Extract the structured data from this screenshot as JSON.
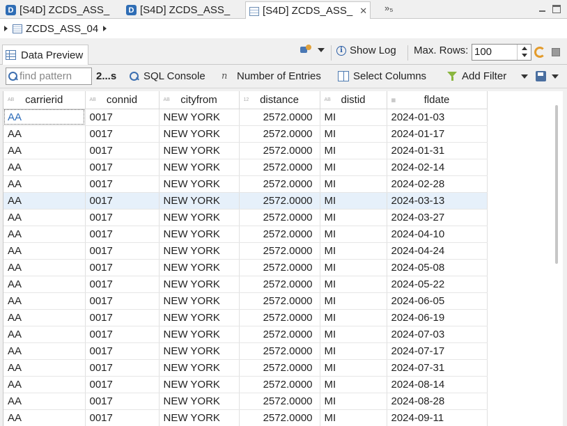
{
  "editor_tabs": [
    {
      "label": "[S4D] ZCDS_ASS_",
      "icon": "ddic-d-icon"
    },
    {
      "label": "[S4D] ZCDS_ASS_",
      "icon": "ddic-d-icon"
    },
    {
      "label": "[S4D] ZCDS_ASS_",
      "icon": "data-preview-icon",
      "active": true
    }
  ],
  "tab_overflow": "»₅",
  "breadcrumb": {
    "entity": "ZCDS_ASS_04"
  },
  "view": {
    "tab_label": "Data Preview"
  },
  "header": {
    "show_log": "Show Log",
    "max_rows_label": "Max. Rows:",
    "max_rows_value": "100"
  },
  "toolbar": {
    "find_placeholder": "find pattern",
    "count": "2...s",
    "sql_console": "SQL Console",
    "number_of_entries": "Number of Entries",
    "select_columns": "Select Columns",
    "add_filter": "Add Filter"
  },
  "table": {
    "columns": [
      {
        "label": "carrierid",
        "type": "AB"
      },
      {
        "label": "connid",
        "type": "AB"
      },
      {
        "label": "cityfrom",
        "type": "AB"
      },
      {
        "label": "distance",
        "type": "12"
      },
      {
        "label": "distid",
        "type": "AB"
      },
      {
        "label": "fldate",
        "type": "date"
      }
    ],
    "rows": [
      [
        "AA",
        "0017",
        "NEW YORK",
        "2572.0000",
        "MI",
        "2024-01-03"
      ],
      [
        "AA",
        "0017",
        "NEW YORK",
        "2572.0000",
        "MI",
        "2024-01-17"
      ],
      [
        "AA",
        "0017",
        "NEW YORK",
        "2572.0000",
        "MI",
        "2024-01-31"
      ],
      [
        "AA",
        "0017",
        "NEW YORK",
        "2572.0000",
        "MI",
        "2024-02-14"
      ],
      [
        "AA",
        "0017",
        "NEW YORK",
        "2572.0000",
        "MI",
        "2024-02-28"
      ],
      [
        "AA",
        "0017",
        "NEW YORK",
        "2572.0000",
        "MI",
        "2024-03-13"
      ],
      [
        "AA",
        "0017",
        "NEW YORK",
        "2572.0000",
        "MI",
        "2024-03-27"
      ],
      [
        "AA",
        "0017",
        "NEW YORK",
        "2572.0000",
        "MI",
        "2024-04-10"
      ],
      [
        "AA",
        "0017",
        "NEW YORK",
        "2572.0000",
        "MI",
        "2024-04-24"
      ],
      [
        "AA",
        "0017",
        "NEW YORK",
        "2572.0000",
        "MI",
        "2024-05-08"
      ],
      [
        "AA",
        "0017",
        "NEW YORK",
        "2572.0000",
        "MI",
        "2024-05-22"
      ],
      [
        "AA",
        "0017",
        "NEW YORK",
        "2572.0000",
        "MI",
        "2024-06-05"
      ],
      [
        "AA",
        "0017",
        "NEW YORK",
        "2572.0000",
        "MI",
        "2024-06-19"
      ],
      [
        "AA",
        "0017",
        "NEW YORK",
        "2572.0000",
        "MI",
        "2024-07-03"
      ],
      [
        "AA",
        "0017",
        "NEW YORK",
        "2572.0000",
        "MI",
        "2024-07-17"
      ],
      [
        "AA",
        "0017",
        "NEW YORK",
        "2572.0000",
        "MI",
        "2024-07-31"
      ],
      [
        "AA",
        "0017",
        "NEW YORK",
        "2572.0000",
        "MI",
        "2024-08-14"
      ],
      [
        "AA",
        "0017",
        "NEW YORK",
        "2572.0000",
        "MI",
        "2024-08-28"
      ],
      [
        "AA",
        "0017",
        "NEW YORK",
        "2572.0000",
        "MI",
        "2024-09-11"
      ]
    ],
    "selected_row": 5,
    "focused_cell": [
      0,
      0
    ]
  },
  "colors": {
    "selection": "#e6f0fa",
    "accent": "#2f6db5"
  }
}
